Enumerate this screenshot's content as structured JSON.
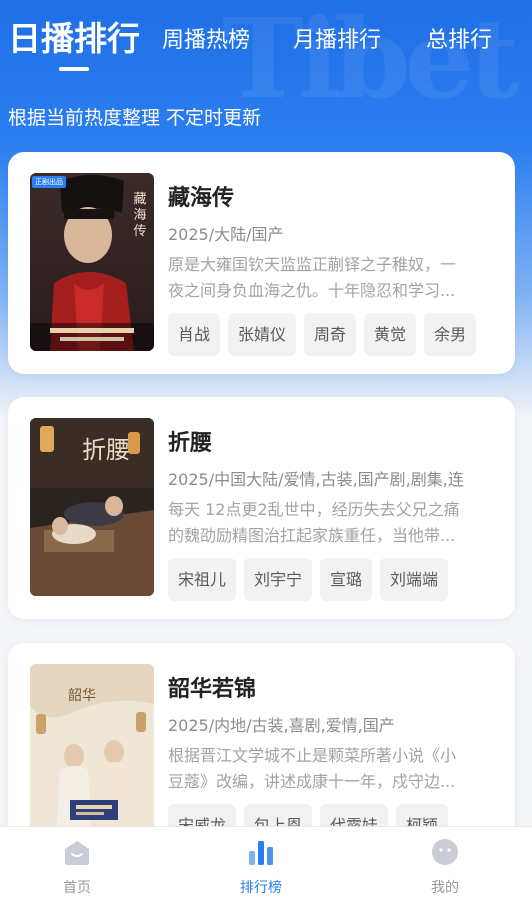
{
  "tabs": {
    "daily": "日播排行",
    "weekly": "周播热榜",
    "monthly": "月播排行",
    "total": "总排行"
  },
  "subtitle": "根据当前热度整理 不定时更新",
  "hero_watermark": "Tibet",
  "dramas": [
    {
      "title": "藏海传",
      "meta": "2025/大陆/国产",
      "desc_line1": "原是大雍国钦天监监正蒯铎之子稚奴，一",
      "desc_line2": "夜之间身负血海之仇。十年隐忍和学习...",
      "tags": [
        "肖战",
        "张婧仪",
        "周奇",
        "黄觉",
        "余男"
      ],
      "badge": "正剧出品"
    },
    {
      "title": "折腰",
      "meta": "2025/中国大陆/爱情,古装,国产剧,剧集,连",
      "desc_line1": "每天 12点更2乱世中，经历失去父兄之痛",
      "desc_line2": "的魏劭励精图治扛起家族重任，当他带...",
      "tags": [
        "宋祖儿",
        "刘宇宁",
        "宣璐",
        "刘端端"
      ]
    },
    {
      "title": "韶华若锦",
      "meta": "2025/内地/古装,喜剧,爱情,国产",
      "desc_line1": "根据晋江文学城不止是颗菜所著小说《小",
      "desc_line2": "豆蔻》改编，讲述成康十一年，戍守边...",
      "tags": [
        "宋威龙",
        "包上恩",
        "代露娃",
        "柯颖"
      ]
    }
  ],
  "nav": {
    "home": "首页",
    "rank": "排行榜",
    "mine": "我的"
  },
  "colors": {
    "accent": "#2a7ef0",
    "hero_top": "#1f6fe6",
    "page_bg": "#f3f5f8"
  }
}
